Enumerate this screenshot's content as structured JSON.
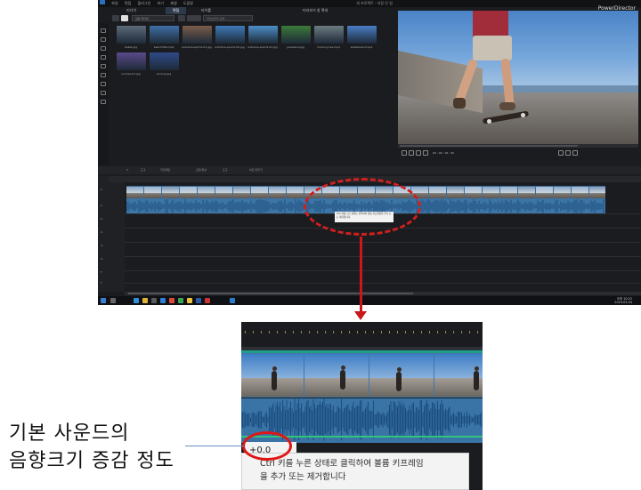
{
  "app": {
    "brand": "PowerDirector",
    "window_title": "새 프로젝트 - 저장 안 됨",
    "menu": [
      "파일",
      "편집",
      "플러그인",
      "보기",
      "재생",
      "도움말"
    ],
    "library_tabs": [
      "미디어",
      "편집",
      "타이틀",
      "미리보기 창 확대"
    ],
    "filter_label": "모든 미디어",
    "search_placeholder": "라이브러리 검색",
    "media": [
      {
        "name": "ballet.jpg",
        "color": "#5c6a7a"
      },
      {
        "name": "beach360.mp4",
        "color": "#3f6fa6"
      },
      {
        "name": "extreme-sports-01.jpg",
        "color": "#7a5c4a"
      },
      {
        "name": "extreme-sports-02.jpg",
        "color": "#3f7ab8"
      },
      {
        "name": "extreme-sports-03.jpg",
        "color": "#4c8fc8"
      },
      {
        "name": "grassland.jpg",
        "color": "#3c7a3a"
      },
      {
        "name": "motorcycles.mp4",
        "color": "#6d7c82"
      },
      {
        "name": "skateboard.mp4",
        "color": "#4a7ec4"
      },
      {
        "name": "sunrise-01.jpg",
        "color": "#5a4a8a"
      },
      {
        "name": "sunrise.jpg",
        "color": "#2f4a8a"
      }
    ],
    "timecode": "00 ; 00 ; 16 ; 00",
    "timeline_toolbar": [
      "도구",
      "키프레임",
      "교정/향상",
      "도구",
      "비트 맞추기"
    ],
    "tracks": [
      "1.",
      "1.",
      "2.",
      "2.",
      "3.",
      "3.",
      "T",
      "T"
    ],
    "tooltip_small": "Ctrl 키를 누른 상태로 클릭하여 볼륨 키프레임을 추가 또는 제거합니다",
    "clock_time": "오후 10:22",
    "clock_date": "2019-03-04"
  },
  "zoom": {
    "volume_value": "+0.0",
    "tooltip_line1": "Ctrl 키를 누른 상태로 클릭하여 볼륨 키프레임",
    "tooltip_line2": "을 추가 또는 제거합니다"
  },
  "annotation": {
    "line1": "기본 사운드의",
    "line2": "음향크기 증감 정도"
  },
  "colors": {
    "highlight": "#d11f1f",
    "audio_track": "#3a74a6",
    "video_track": "#3f77a8"
  }
}
